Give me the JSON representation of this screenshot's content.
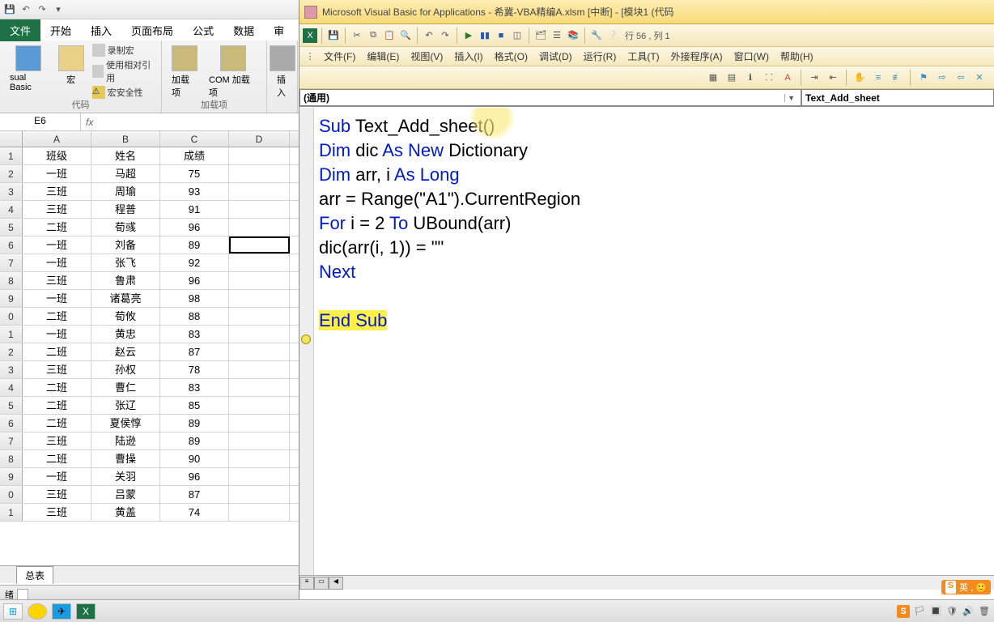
{
  "excel": {
    "qat": {
      "save": "💾",
      "undo": "↶",
      "redo": "↷",
      "down": "▾"
    },
    "tabs": {
      "file": "文件",
      "home": "开始",
      "insert": "插入",
      "page": "页面布局",
      "formula": "公式",
      "data": "数据",
      "review": "审"
    },
    "ribbon": {
      "vb_label": "sual Basic",
      "macro_label": "宏",
      "record": "录制宏",
      "relref": "使用相对引用",
      "security": "宏安全性",
      "group1": "代码",
      "addin": "加载项",
      "comaddin": "COM 加载项",
      "group2": "加载项",
      "insert_ctrl": "插入"
    },
    "namebox": "E6",
    "fx": "fx",
    "cols": [
      "A",
      "B",
      "C",
      "D"
    ],
    "rows": [
      {
        "n": "1",
        "a": "班级",
        "b": "姓名",
        "c": "成绩",
        "d": ""
      },
      {
        "n": "2",
        "a": "一班",
        "b": "马超",
        "c": "75",
        "d": ""
      },
      {
        "n": "3",
        "a": "三班",
        "b": "周瑜",
        "c": "93",
        "d": ""
      },
      {
        "n": "4",
        "a": "三班",
        "b": "程普",
        "c": "91",
        "d": ""
      },
      {
        "n": "5",
        "a": "二班",
        "b": "荀彧",
        "c": "96",
        "d": ""
      },
      {
        "n": "6",
        "a": "一班",
        "b": "刘备",
        "c": "89",
        "d": ""
      },
      {
        "n": "7",
        "a": "一班",
        "b": "张飞",
        "c": "92",
        "d": ""
      },
      {
        "n": "8",
        "a": "三班",
        "b": "鲁肃",
        "c": "96",
        "d": ""
      },
      {
        "n": "9",
        "a": "一班",
        "b": "诸葛亮",
        "c": "98",
        "d": ""
      },
      {
        "n": "0",
        "a": "二班",
        "b": "荀攸",
        "c": "88",
        "d": ""
      },
      {
        "n": "1",
        "a": "一班",
        "b": "黄忠",
        "c": "83",
        "d": ""
      },
      {
        "n": "2",
        "a": "二班",
        "b": "赵云",
        "c": "87",
        "d": ""
      },
      {
        "n": "3",
        "a": "三班",
        "b": "孙权",
        "c": "78",
        "d": ""
      },
      {
        "n": "4",
        "a": "二班",
        "b": "曹仁",
        "c": "83",
        "d": ""
      },
      {
        "n": "5",
        "a": "二班",
        "b": "张辽",
        "c": "85",
        "d": ""
      },
      {
        "n": "6",
        "a": "二班",
        "b": "夏侯惇",
        "c": "89",
        "d": ""
      },
      {
        "n": "7",
        "a": "三班",
        "b": "陆逊",
        "c": "89",
        "d": ""
      },
      {
        "n": "8",
        "a": "二班",
        "b": "曹操",
        "c": "90",
        "d": ""
      },
      {
        "n": "9",
        "a": "一班",
        "b": "关羽",
        "c": "96",
        "d": ""
      },
      {
        "n": "0",
        "a": "三班",
        "b": "吕蒙",
        "c": "87",
        "d": ""
      },
      {
        "n": "1",
        "a": "三班",
        "b": "黄盖",
        "c": "74",
        "d": ""
      }
    ],
    "sheet_tab": "总表",
    "status": "绪"
  },
  "vbe": {
    "title": "Microsoft Visual Basic for Applications - 希冀-VBA精编A.xlsm [中断] - [模块1 (代码",
    "toolbar_pos": "行 56 , 列 1",
    "menus": {
      "file": "文件(F)",
      "edit": "编辑(E)",
      "view": "视图(V)",
      "insert": "插入(I)",
      "format": "格式(O)",
      "debug": "调试(D)",
      "run": "运行(R)",
      "tools": "工具(T)",
      "addins": "外接程序(A)",
      "window": "窗口(W)",
      "help": "帮助(H)"
    },
    "dd_left": "(通用)",
    "dd_right": "Text_Add_sheet",
    "code": {
      "l1a": "Sub",
      "l1b": " Text_Add_sheet()",
      "l2a": "Dim",
      "l2b": " dic ",
      "l2c": "As New",
      "l2d": " Dictionary",
      "l3a": "Dim",
      "l3b": " arr, i ",
      "l3c": "As Long",
      "l4": "arr = Range(\"A1\").CurrentRegion",
      "l5a": "For",
      "l5b": " i = 2 ",
      "l5c": "To",
      "l5d": " UBound(arr)",
      "l6": "    dic(arr(i, 1)) = \"\"",
      "l7": "Next",
      "l9a": "End Sub"
    }
  },
  "taskbar": {
    "ime": "S",
    "ime_text": "英 , 🙂"
  }
}
